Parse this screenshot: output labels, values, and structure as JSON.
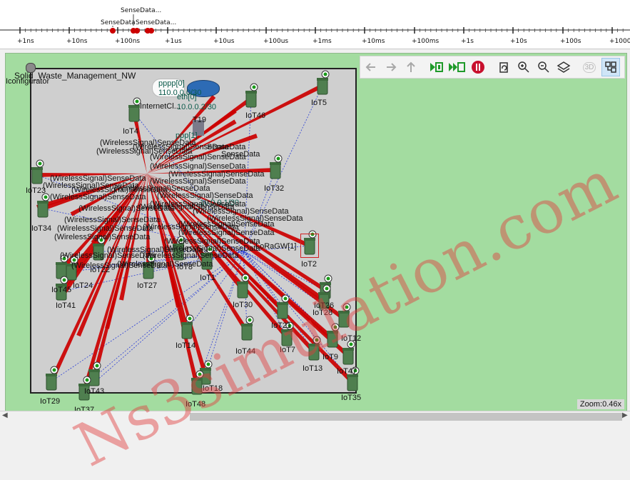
{
  "timeline": {
    "events_top_label": "SenseData...",
    "events": [
      "SenseData",
      "SenseData..."
    ],
    "ticks": [
      "+1ns",
      "+10ns",
      "+100ns",
      "+1us",
      "+10us",
      "+100us",
      "+1ms",
      "+10ms",
      "+100ms",
      "+1s",
      "+10s",
      "+100s",
      "+1000s"
    ]
  },
  "toolbar": {
    "buttons": [
      "back-arrow",
      "forward-arrow",
      "up-arrow",
      "run-until-next-event",
      "fast-forward",
      "stop",
      "refresh",
      "zoom-in",
      "zoom-out",
      "layers",
      "3d-view",
      "layout-arrange"
    ],
    "view3d_label": "3D"
  },
  "network": {
    "title": "Solid_Waste_Management_NW",
    "configurator": "Iconfigurator",
    "router_labels": [
      "pppp[0]",
      "110.0.0.0/30",
      "eth[0]",
      "10.0.0.2/30",
      "ppp[1]",
      "10.0.0.1/30"
    ],
    "node_labels": {
      "internet_cloud": "InternetCl...",
      "gateway": "LoRaGW[1]",
      "iot5": "IoT5",
      "iot4": "IoT4",
      "iot46": "IoT46",
      "iot32": "IoT32",
      "iot23": "IoT23",
      "iot34": "IoT34",
      "iot2": "IoT2",
      "iot22": "IoT22",
      "iot45": "IoT45",
      "iot24": "IoT24",
      "iot41": "IoT41",
      "iot27": "IoT27",
      "iot8": "IoT8",
      "iot1": "IoT1",
      "iot30": "IoT30",
      "iot26": "IoT26",
      "iot28": "IoT28",
      "iot21": "IoT21",
      "iot12": "IoT12",
      "iot14": "IoT14",
      "iot44": "IoT44",
      "iot7": "IoT7",
      "iot9": "IoT9",
      "iot13": "IoT13",
      "iot47": "IoT47",
      "iot29": "IoT29",
      "iot43": "IoT43",
      "iot37": "IoT37",
      "iot18": "IoT18",
      "iot48": "IoT48",
      "iot35": "IoT35",
      "iot19": "T19"
    },
    "message_label": "(WirelessSignal)SenseData",
    "message_label_short": "SenseData"
  },
  "status": {
    "zoom": "Zoom:0.46x"
  },
  "watermark": "Ns3simulation.com",
  "colors": {
    "canvas": "#a3dca0",
    "network_bg": "#cfcfcf",
    "signal": "#cc0000",
    "link": "#2a3fd6",
    "bin": "#4f7f4f"
  }
}
